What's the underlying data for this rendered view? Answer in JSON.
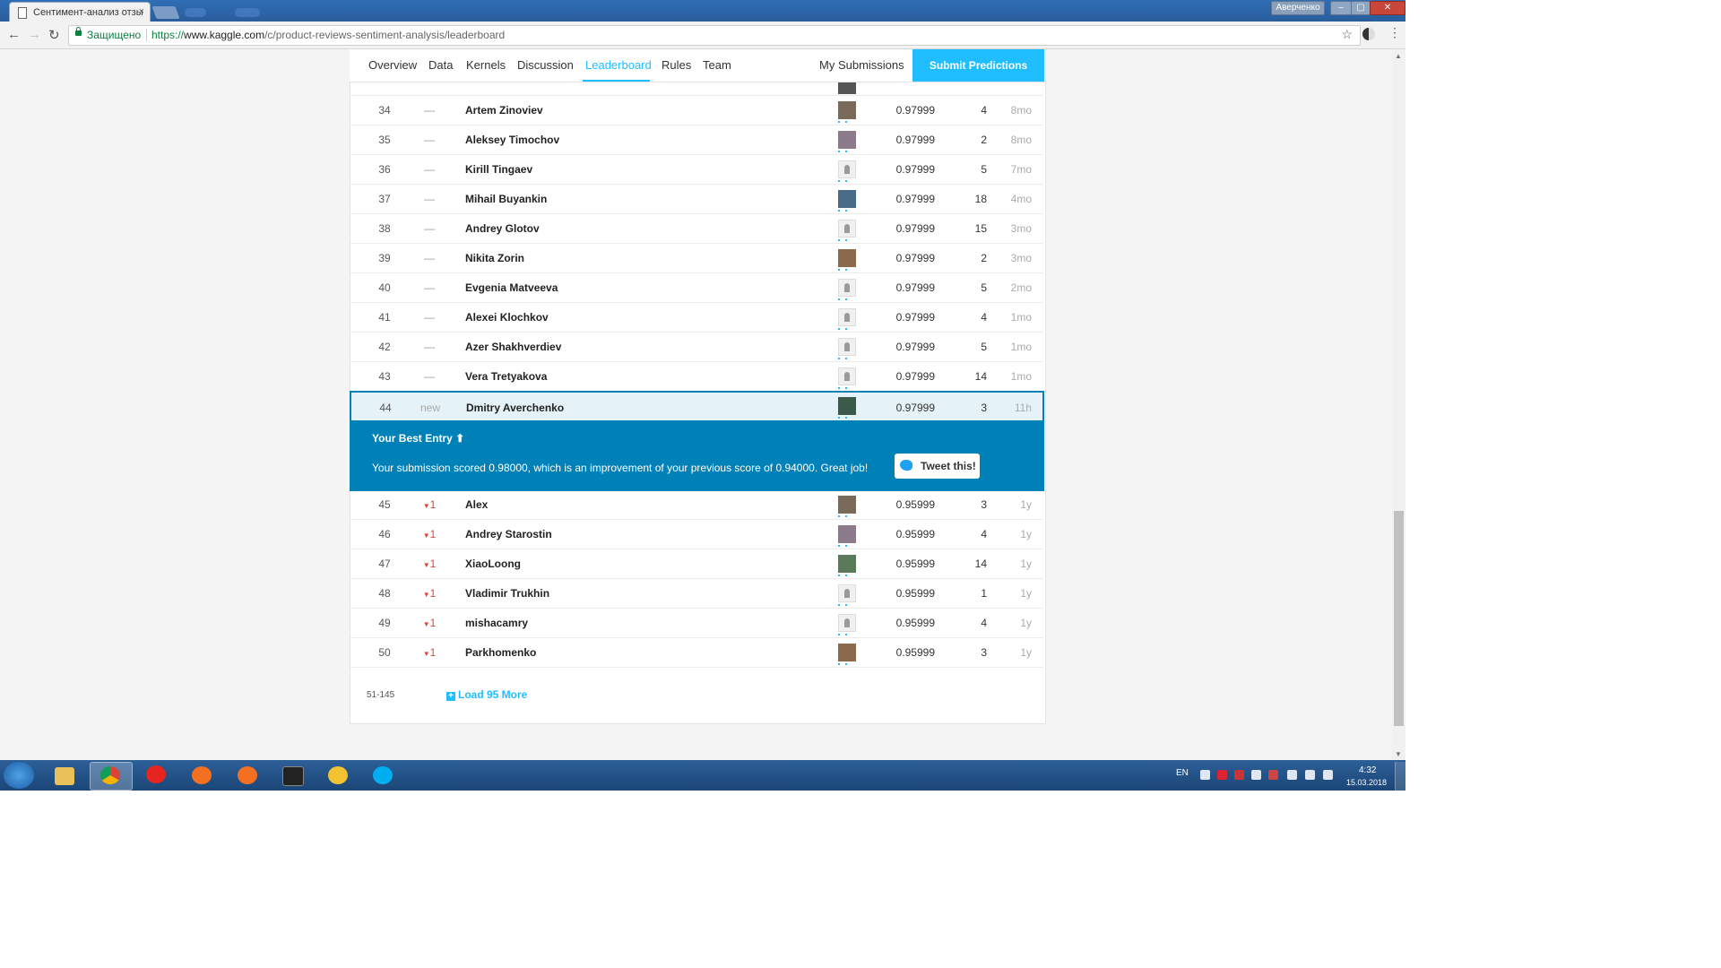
{
  "browser": {
    "tab_title": "Сентимент-анализ отзы",
    "tab_close": "×",
    "user_chip": "Аверченко",
    "secure_label": "Защищено",
    "url_scheme": "https://",
    "url_host": "www.kaggle.com",
    "url_path": "/c/product-reviews-sentiment-analysis/leaderboard",
    "star": "☆",
    "menu": "⋮",
    "back": "←",
    "forward": "→",
    "reload": "↻"
  },
  "compnav": {
    "tabs": [
      "Overview",
      "Data",
      "Kernels",
      "Discussion",
      "Leaderboard",
      "Rules",
      "Team"
    ],
    "my_submissions": "My Submissions",
    "submit": "Submit Predictions"
  },
  "rows_top": [
    {
      "rank": "34",
      "change": "—",
      "name": "Artem Zinoviev",
      "score": "0.97999",
      "entries": "4",
      "last": "8mo",
      "avatar": "photo"
    },
    {
      "rank": "35",
      "change": "—",
      "name": "Aleksey Timochov",
      "score": "0.97999",
      "entries": "2",
      "last": "8mo",
      "avatar": "photo"
    },
    {
      "rank": "36",
      "change": "—",
      "name": "Kirill Tingaev",
      "score": "0.97999",
      "entries": "5",
      "last": "7mo",
      "avatar": "default"
    },
    {
      "rank": "37",
      "change": "—",
      "name": "Mihail Buyankin",
      "score": "0.97999",
      "entries": "18",
      "last": "4mo",
      "avatar": "photo"
    },
    {
      "rank": "38",
      "change": "—",
      "name": "Andrey Glotov",
      "score": "0.97999",
      "entries": "15",
      "last": "3mo",
      "avatar": "default"
    },
    {
      "rank": "39",
      "change": "—",
      "name": "Nikita Zorin",
      "score": "0.97999",
      "entries": "2",
      "last": "3mo",
      "avatar": "photo"
    },
    {
      "rank": "40",
      "change": "—",
      "name": "Evgenia Matveeva",
      "score": "0.97999",
      "entries": "5",
      "last": "2mo",
      "avatar": "default"
    },
    {
      "rank": "41",
      "change": "—",
      "name": "Alexei Klochkov",
      "score": "0.97999",
      "entries": "4",
      "last": "1mo",
      "avatar": "default"
    },
    {
      "rank": "42",
      "change": "—",
      "name": "Azer Shakhverdiev",
      "score": "0.97999",
      "entries": "5",
      "last": "1mo",
      "avatar": "default"
    },
    {
      "rank": "43",
      "change": "—",
      "name": "Vera Tretyakova",
      "score": "0.97999",
      "entries": "14",
      "last": "1mo",
      "avatar": "default"
    }
  ],
  "my_row": {
    "rank": "44",
    "change": "new",
    "name": "Dmitry Averchenko",
    "score": "0.97999",
    "entries": "3",
    "last": "11h"
  },
  "best_entry": {
    "title": "Your Best Entry",
    "arrow": "⬆",
    "message": "Your submission scored 0.98000, which is an improvement of your previous score of 0.94000. Great job!",
    "tweet": "Tweet this!"
  },
  "rows_bottom": [
    {
      "rank": "45",
      "change": "1",
      "name": "Alex",
      "score": "0.95999",
      "entries": "3",
      "last": "1y",
      "avatar": "photo"
    },
    {
      "rank": "46",
      "change": "1",
      "name": "Andrey Starostin",
      "score": "0.95999",
      "entries": "4",
      "last": "1y",
      "avatar": "photo"
    },
    {
      "rank": "47",
      "change": "1",
      "name": "XiaoLoong",
      "score": "0.95999",
      "entries": "14",
      "last": "1y",
      "avatar": "photo"
    },
    {
      "rank": "48",
      "change": "1",
      "name": "Vladimir Trukhin",
      "score": "0.95999",
      "entries": "1",
      "last": "1y",
      "avatar": "default"
    },
    {
      "rank": "49",
      "change": "1",
      "name": "mishacamry",
      "score": "0.95999",
      "entries": "4",
      "last": "1y",
      "avatar": "default"
    },
    {
      "rank": "50",
      "change": "1",
      "name": "Parkhomenko",
      "score": "0.95999",
      "entries": "3",
      "last": "1y",
      "avatar": "photo"
    }
  ],
  "footer": {
    "range": "51-145",
    "plus": "+",
    "load_more": "Load 95 More"
  },
  "taskbar": {
    "lang": "EN",
    "time": "4:32",
    "date": "15.03.2018"
  },
  "colors": {
    "accent": "#20beff",
    "best_bg": "#0081b8",
    "down": "#e0453a",
    "taskbar": "#1b4677"
  }
}
